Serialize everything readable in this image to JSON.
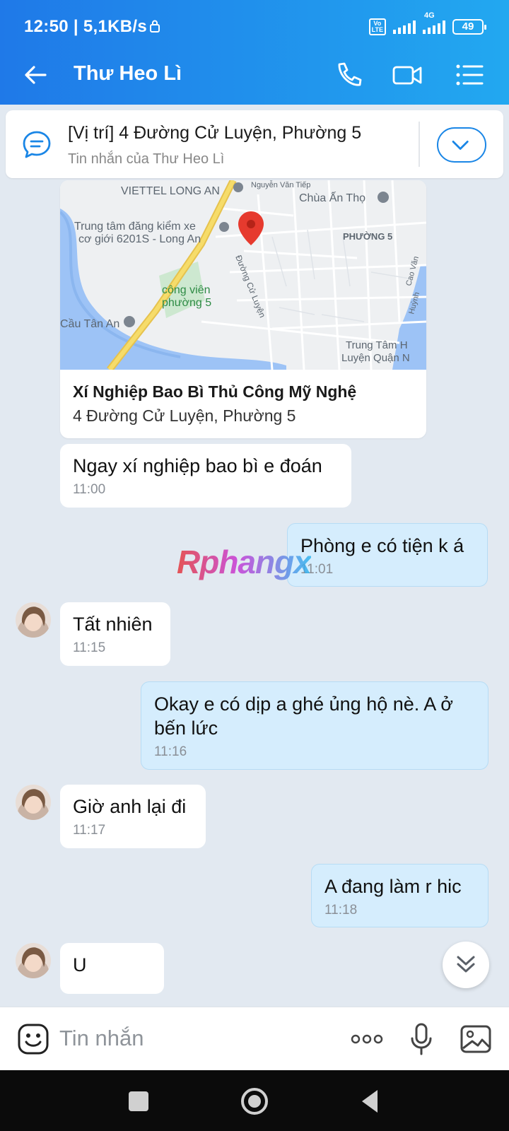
{
  "status_bar": {
    "time": "12:50 | 5,1KB/s",
    "volte_label": "Vo\nLTE",
    "network_label": "4G",
    "battery": "49"
  },
  "header": {
    "title": "Thư Heo Lì",
    "icons": [
      "back-arrow-icon",
      "phone-icon",
      "video-call-icon",
      "menu-list-icon"
    ]
  },
  "pinned": {
    "text": "[Vị trí] 4 Đường Cử Luyện, Phường 5",
    "subtext": "Tin nhắn của Thư Heo Lì"
  },
  "location_card": {
    "title": "Xí Nghiệp Bao Bì Thủ Công Mỹ Nghệ",
    "address": "4 Đường Cử Luyện, Phường 5",
    "map_labels": {
      "viettel": "VIETTEL LONG AN",
      "nguyen_van_tiep": "Nguyễn Văn Tiếp",
      "chua": "Chùa Ấn Thọ",
      "dang_kiem_1": "Trung tâm đăng kiểm xe",
      "dang_kiem_2": "cơ giới 6201S - Long An",
      "phuong5": "PHƯỜNG 5",
      "cao_van": "Cao Văn",
      "huynh": "Huỳnh",
      "cong_vien_1": "công viên",
      "cong_vien_2": "phường 5",
      "duong_cu_luyen": "Đường Cử Luyện",
      "cau_tan_an": "Cầu Tân An",
      "trung_tam_1": "Trung Tâm H",
      "trung_tam_2": "Luyện Quận N"
    }
  },
  "messages": [
    {
      "dir": "in",
      "text": "Ngay xí nghiệp bao bì e đoán",
      "time": "11:00"
    },
    {
      "dir": "out",
      "text": "Phòng e có tiện k á",
      "time": "11:01"
    },
    {
      "dir": "in",
      "text": "Tất nhiên",
      "time": "11:15"
    },
    {
      "dir": "out",
      "text": "Okay e có dịp a ghé ủng hộ nè. A ở bến lức",
      "time": "11:16"
    },
    {
      "dir": "in",
      "text": "Giờ anh lại đi",
      "time": "11:17"
    },
    {
      "dir": "out",
      "text": "A đang làm r hic",
      "time": "11:18"
    },
    {
      "dir": "in",
      "text": "U",
      "time": ""
    }
  ],
  "watermark": "Rphangx",
  "input": {
    "placeholder": "Tin nhắn"
  },
  "colors": {
    "header": "#1f79e8",
    "incoming_bubble": "#ffffff",
    "outgoing_bubble": "#d5edfd",
    "background": "#e2e9f1"
  }
}
